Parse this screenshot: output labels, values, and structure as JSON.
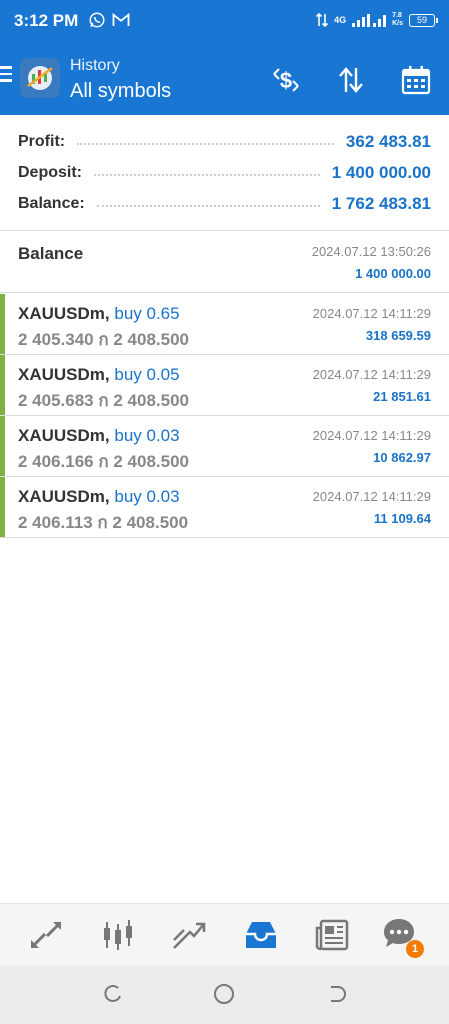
{
  "status_bar": {
    "time": "3:12 PM",
    "network": "4G",
    "speed": "7.8\nK/s",
    "battery": "59",
    "icons": [
      "whatsapp-icon",
      "gmail-icon",
      "signal-icon",
      "battery-icon"
    ]
  },
  "header": {
    "subtitle": "History",
    "title": "All symbols",
    "actions": [
      "currency-exchange-icon",
      "sort-icon",
      "calendar-icon"
    ]
  },
  "summary": {
    "profit_label": "Profit:",
    "profit_value": "362 483.81",
    "deposit_label": "Deposit:",
    "deposit_value": "1 400 000.00",
    "balance_label": "Balance:",
    "balance_value": "1 762 483.81"
  },
  "balance_entry": {
    "label": "Balance",
    "time": "2024.07.12 13:50:26",
    "amount": "1 400 000.00"
  },
  "deals": [
    {
      "symbol": "XAUUSDm,",
      "direction": "buy 0.65",
      "prices": "2 405.340 ‌ก 2 408.500",
      "time": "2024.07.12 14:11:29",
      "profit": "318 659.59"
    },
    {
      "symbol": "XAUUSDm,",
      "direction": "buy 0.05",
      "prices": "2 405.683 ‌ก 2 408.500",
      "time": "2024.07.12 14:11:29",
      "profit": "21 851.61"
    },
    {
      "symbol": "XAUUSDm,",
      "direction": "buy 0.03",
      "prices": "2 406.166 ‌ก 2 408.500",
      "time": "2024.07.12 14:11:29",
      "profit": "10 862.97"
    },
    {
      "symbol": "XAUUSDm,",
      "direction": "buy 0.03",
      "prices": "2 406.113 ‌ก 2 408.500",
      "time": "2024.07.12 14:11:29",
      "profit": "11 109.64"
    }
  ],
  "bottom_nav": {
    "items": [
      "quotes-icon",
      "chart-icon",
      "trade-icon",
      "history-icon",
      "news-icon",
      "messages-icon"
    ],
    "active": "history-icon",
    "messages_badge": "1"
  },
  "colors": {
    "primary": "#1976d2",
    "value_blue": "#1a73c9",
    "buy_bar": "#7cb342",
    "badge": "#f57c00"
  }
}
